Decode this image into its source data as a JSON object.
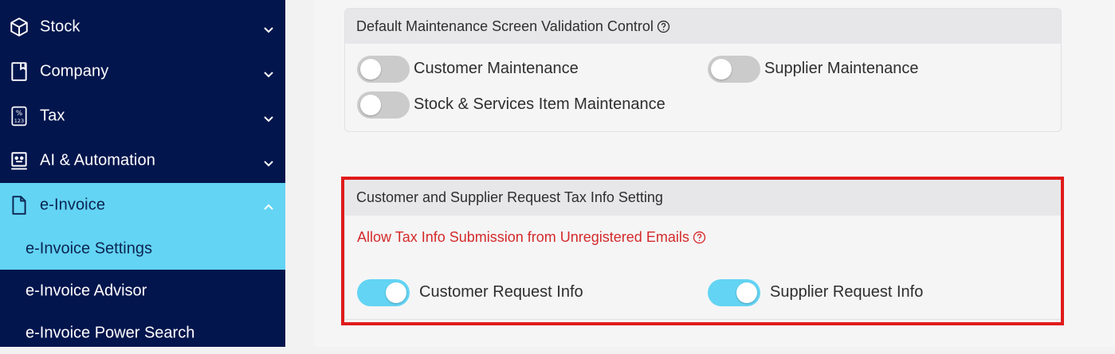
{
  "sidebar": {
    "items": [
      {
        "label": "Stock",
        "icon": "cube-icon"
      },
      {
        "label": "Company",
        "icon": "bookmark-icon"
      },
      {
        "label": "Tax",
        "icon": "percent-calculator-icon"
      },
      {
        "label": "AI & Automation",
        "icon": "robot-icon"
      },
      {
        "label": "e-Invoice",
        "icon": "document-icon"
      }
    ],
    "subitems": [
      {
        "label": "e-Invoice Settings"
      },
      {
        "label": "e-Invoice Advisor"
      },
      {
        "label": "e-Invoice Power Search"
      }
    ]
  },
  "validation_panel": {
    "title": "Default Maintenance Screen Validation Control",
    "toggles": [
      {
        "label": "Customer Maintenance",
        "state": "off"
      },
      {
        "label": "Supplier Maintenance",
        "state": "off"
      },
      {
        "label": "Stock & Services Item Maintenance",
        "state": "off"
      }
    ]
  },
  "taxinfo_panel": {
    "title": "Customer and Supplier Request Tax Info Setting",
    "warning": "Allow Tax Info Submission from Unregistered Emails",
    "toggles": [
      {
        "label": "Customer Request Info",
        "state": "on"
      },
      {
        "label": "Supplier Request Info",
        "state": "on"
      }
    ]
  },
  "colors": {
    "sidebar_bg": "#03154d",
    "active_bg": "#63d4f3",
    "highlight_border": "#e01b1b",
    "warning_text": "#d42a2a"
  }
}
